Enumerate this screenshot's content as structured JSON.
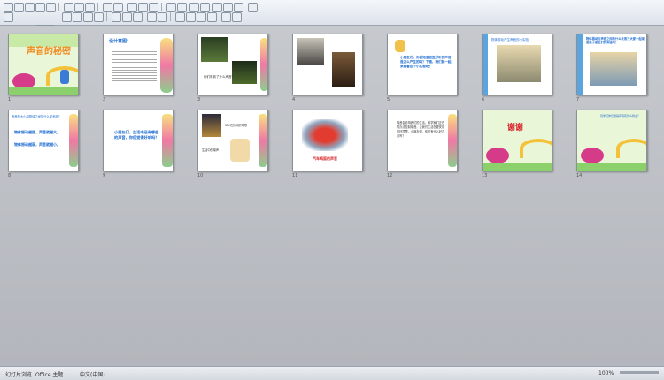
{
  "toolbar": {
    "font_size": "15"
  },
  "slides": [
    {
      "num": "1",
      "title": "声音的秘密",
      "title_color": "#f08a1c"
    },
    {
      "num": "2",
      "heading": "设计意图：",
      "body": "本课是科学五年级上册……"
    },
    {
      "num": "3",
      "caption": "你们听到了什么声音？"
    },
    {
      "num": "4"
    },
    {
      "num": "5",
      "text": "小朋友们，你们知道这些好听的声音是怎么产生的吗？下面，我们就一起来看看这个小实验吧！"
    },
    {
      "num": "6",
      "text": "物体振动产生声音的小实验"
    },
    {
      "num": "7",
      "text": "物体振动与声音之间有什么关系？大家一起来做做小朋友们的实验吧！"
    },
    {
      "num": "8",
      "title": "声音的大小和物体之间的什么关系呢？",
      "line1": "物体振动越强，声音就越大。",
      "line2": "物体振动越弱，声音就越小。"
    },
    {
      "num": "9",
      "text": "小朋友们，生活中还有哪些的声音，你们觉得好听吗？"
    },
    {
      "num": "10",
      "text": "KTV在热闹的唱歌",
      "text2": "生活中的噪声"
    },
    {
      "num": "11",
      "text": "汽车鸣笛的声音"
    },
    {
      "num": "12",
      "text": "噪音会影响我们的生活，科学家们正在想办法控制噪音，让我们生活在更安静的环境里。小朋友们，你们有什么好办法吗？"
    },
    {
      "num": "13",
      "title": "谢谢"
    },
    {
      "num": "14",
      "text": "同学们你们觉得声音有什么特点？"
    }
  ],
  "status": {
    "slide_sorter": "幻灯片浏览",
    "theme": "Office 主题",
    "language": "中文(中国)",
    "zoom": "100%"
  },
  "colors": {
    "accent": "#f08a1c",
    "blue": "#1c6bd1",
    "red": "#d9252a"
  }
}
